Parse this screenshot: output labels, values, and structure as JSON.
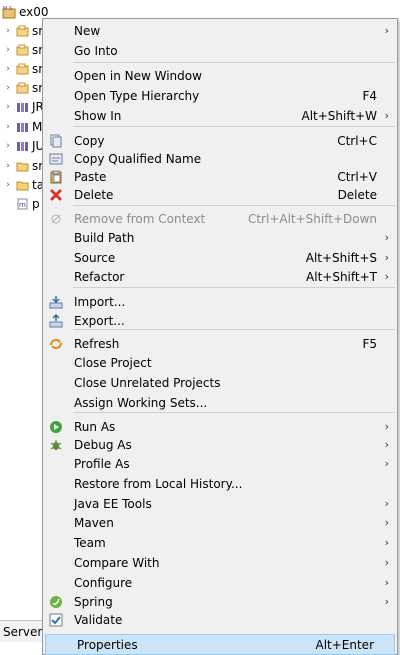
{
  "tree": {
    "root_label": "ex00",
    "rows": [
      {
        "label": "sr",
        "icon": "package-icon",
        "color": "#c8912a"
      },
      {
        "label": "sr",
        "icon": "package-icon",
        "color": "#c8912a"
      },
      {
        "label": "sr",
        "icon": "package-icon",
        "color": "#c8912a"
      },
      {
        "label": "sr",
        "icon": "package-icon",
        "color": "#c8912a"
      },
      {
        "label": "JR",
        "icon": "library-icon",
        "color": "#6b5fa6"
      },
      {
        "label": "M",
        "icon": "library-icon",
        "color": "#6b5fa6"
      },
      {
        "label": "JU",
        "icon": "library-icon",
        "color": "#6b5fa6"
      },
      {
        "label": "sr",
        "icon": "folder-icon",
        "color": "#e3b64a"
      },
      {
        "label": "ta",
        "icon": "folder-icon",
        "color": "#e3b64a"
      },
      {
        "label": "p",
        "icon": "pom-file-icon",
        "color": "#2b5797"
      }
    ]
  },
  "bottom_tab": {
    "label": "Servers"
  },
  "menu": {
    "items": [
      {
        "label": "New",
        "shortcut": "",
        "submenu": true
      },
      {
        "label": "Go Into",
        "shortcut": "",
        "submenu": false
      },
      {
        "label": "Open in New Window",
        "shortcut": "",
        "submenu": false
      },
      {
        "label": "Open Type Hierarchy",
        "shortcut": "F4",
        "submenu": false
      },
      {
        "label": "Show In",
        "shortcut": "Alt+Shift+W",
        "submenu": true
      },
      {
        "label": "Copy",
        "shortcut": "Ctrl+C",
        "submenu": false,
        "icon": "copy-icon"
      },
      {
        "label": "Copy Qualified Name",
        "shortcut": "",
        "submenu": false,
        "icon": "copy-qualified-name-icon"
      },
      {
        "label": "Paste",
        "shortcut": "Ctrl+V",
        "submenu": false,
        "icon": "paste-icon"
      },
      {
        "label": "Delete",
        "shortcut": "Delete",
        "submenu": false,
        "icon": "delete-icon"
      },
      {
        "label": "Remove from Context",
        "shortcut": "Ctrl+Alt+Shift+Down",
        "submenu": false,
        "icon": "remove-context-icon",
        "disabled": true
      },
      {
        "label": "Build Path",
        "shortcut": "",
        "submenu": true
      },
      {
        "label": "Source",
        "shortcut": "Alt+Shift+S",
        "submenu": true
      },
      {
        "label": "Refactor",
        "shortcut": "Alt+Shift+T",
        "submenu": true
      },
      {
        "label": "Import...",
        "shortcut": "",
        "submenu": false,
        "icon": "import-icon"
      },
      {
        "label": "Export...",
        "shortcut": "",
        "submenu": false,
        "icon": "export-icon"
      },
      {
        "label": "Refresh",
        "shortcut": "F5",
        "submenu": false,
        "icon": "refresh-icon"
      },
      {
        "label": "Close Project",
        "shortcut": "",
        "submenu": false
      },
      {
        "label": "Close Unrelated Projects",
        "shortcut": "",
        "submenu": false
      },
      {
        "label": "Assign Working Sets...",
        "shortcut": "",
        "submenu": false
      },
      {
        "label": "Run As",
        "shortcut": "",
        "submenu": true,
        "icon": "run-icon"
      },
      {
        "label": "Debug As",
        "shortcut": "",
        "submenu": true,
        "icon": "debug-icon"
      },
      {
        "label": "Profile As",
        "shortcut": "",
        "submenu": true
      },
      {
        "label": "Restore from Local History...",
        "shortcut": "",
        "submenu": false
      },
      {
        "label": "Java EE Tools",
        "shortcut": "",
        "submenu": true
      },
      {
        "label": "Maven",
        "shortcut": "",
        "submenu": true
      },
      {
        "label": "Team",
        "shortcut": "",
        "submenu": true
      },
      {
        "label": "Compare With",
        "shortcut": "",
        "submenu": true
      },
      {
        "label": "Configure",
        "shortcut": "",
        "submenu": true
      },
      {
        "label": "Spring",
        "shortcut": "",
        "submenu": true,
        "icon": "spring-icon"
      },
      {
        "label": "Validate",
        "shortcut": "",
        "submenu": false,
        "icon": "validate-checkbox-icon"
      },
      {
        "label": "Properties",
        "shortcut": "Alt+Enter",
        "submenu": false,
        "selected": true
      }
    ],
    "arrow_glyph": "›",
    "highlight_color": "#cce4f7"
  }
}
